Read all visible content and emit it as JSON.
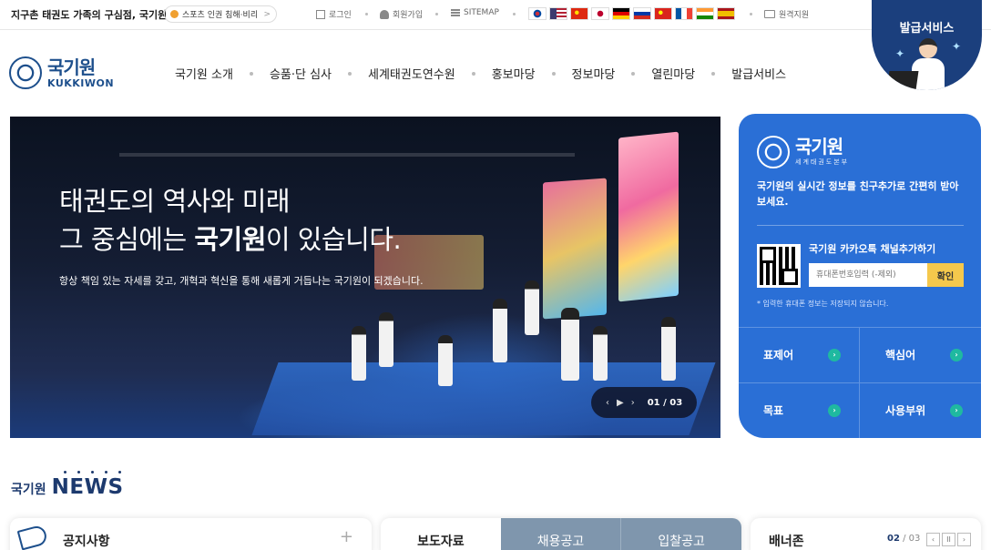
{
  "topbar": {
    "slogan": "지구촌 태권도 가족의 구심점, 국기원",
    "pill_label": "스포츠 인권 침해·비리",
    "pill_arrow": ">",
    "login": "로그인",
    "join": "회원가입",
    "sitemap": "SITEMAP",
    "remote": "원격지원",
    "flags": [
      {
        "code": "kr",
        "colors": [
          "#ffffff",
          "#cd2e3a",
          "#0047a0"
        ]
      },
      {
        "code": "us",
        "colors": [
          "#b22234",
          "#ffffff",
          "#3c3b6e"
        ]
      },
      {
        "code": "cn",
        "colors": [
          "#de2910",
          "#ffde00"
        ]
      },
      {
        "code": "jp",
        "colors": [
          "#ffffff",
          "#bc002d"
        ]
      },
      {
        "code": "de",
        "colors": [
          "#000000",
          "#dd0000",
          "#ffce00"
        ]
      },
      {
        "code": "ru",
        "colors": [
          "#ffffff",
          "#0039a6",
          "#d52b1e"
        ]
      },
      {
        "code": "vn",
        "colors": [
          "#da251d",
          "#ffff00"
        ]
      },
      {
        "code": "fr",
        "colors": [
          "#0055a4",
          "#ffffff",
          "#ef4135"
        ]
      },
      {
        "code": "in",
        "colors": [
          "#ff9933",
          "#ffffff",
          "#138808"
        ]
      },
      {
        "code": "es",
        "colors": [
          "#aa151b",
          "#f1bf00"
        ]
      }
    ]
  },
  "header": {
    "logo_ko": "국기원",
    "logo_en": "KUKKIWON",
    "nav": [
      "국기원 소개",
      "승품·단 심사",
      "세계태권도연수원",
      "홍보마당",
      "정보마당",
      "열린마당",
      "발급서비스"
    ],
    "issue_badge": "발급서비스"
  },
  "hero": {
    "line1": "태권도의 역사와 미래",
    "line2_pre": "그 중심에는 ",
    "line2_bold": "국기원",
    "line2_post": "이 있습니다.",
    "desc": "항상 책임 있는 자세를 갖고, 개혁과 혁신을 통해 새롭게 거듭나는 국기원이 되겠습니다.",
    "prev": "‹",
    "play": "▶",
    "next": "›",
    "page": "01 / 03"
  },
  "panel": {
    "logo_ko": "국기원",
    "logo_sub": "세계태권도본부",
    "message": "국기원의 실시간 정보를 친구추가로 간편히 받아보세요.",
    "kakao_title": "국기원 카카오톡 채널추가하기",
    "phone_placeholder": "휴대폰번호입력 (-제외)",
    "confirm": "확인",
    "note": "* 입력한 휴대폰 정보는 저장되지 않습니다.",
    "links": [
      "표제어",
      "핵심어",
      "목표",
      "사용부위"
    ],
    "accent": "#2a6fd6"
  },
  "news": {
    "title_ko": "국기원",
    "title_en": "NEWS",
    "notice": "공지사항",
    "plus": "+",
    "tabs": [
      "보도자료",
      "채용공고",
      "입찰공고"
    ],
    "banner": "배너존",
    "banner_page_current": "02",
    "banner_page_total": "/ 03",
    "banner_nav": [
      "‹",
      "II",
      "›"
    ]
  }
}
